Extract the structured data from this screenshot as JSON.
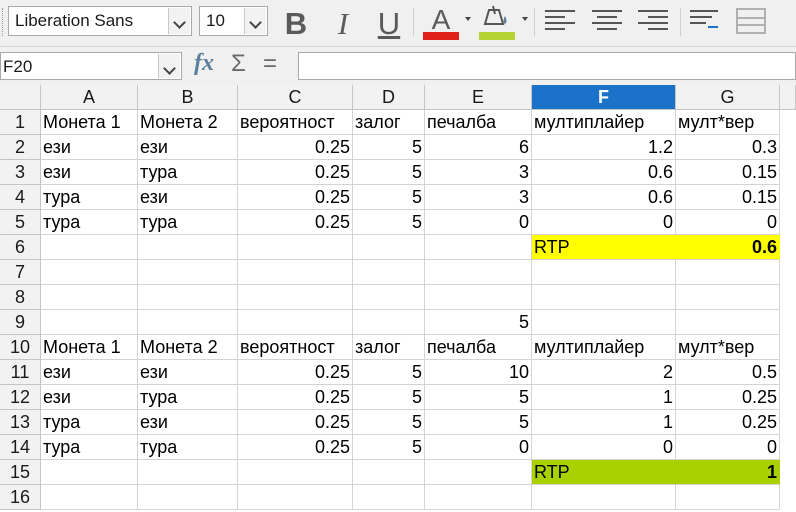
{
  "toolbar": {
    "font_name": "Liberation Sans",
    "font_size": "10",
    "bold_label": "B",
    "italic_label": "I",
    "underline_label": "U",
    "font_color_label": "A",
    "font_color": "#e0201b",
    "highlight_color": "#b5d334"
  },
  "formula_bar": {
    "name_box": "F20",
    "fx_label": "fx",
    "sum_label": "Σ",
    "equals_label": "=",
    "content": ""
  },
  "columns": [
    "A",
    "B",
    "C",
    "D",
    "E",
    "F",
    "G"
  ],
  "selected_column": "F",
  "row_numbers": [
    "1",
    "2",
    "3",
    "4",
    "5",
    "6",
    "7",
    "8",
    "9",
    "10",
    "11",
    "12",
    "13",
    "14",
    "15",
    "16"
  ],
  "cells": [
    {
      "ref": "A1",
      "v": "Монета 1"
    },
    {
      "ref": "B1",
      "v": "Монета 2"
    },
    {
      "ref": "C1",
      "v": "вероятност"
    },
    {
      "ref": "D1",
      "v": "залог"
    },
    {
      "ref": "E1",
      "v": "печалба"
    },
    {
      "ref": "F1",
      "v": "мултиплайер"
    },
    {
      "ref": "G1",
      "v": "мулт*вер"
    },
    {
      "ref": "A2",
      "v": "ези"
    },
    {
      "ref": "B2",
      "v": "ези"
    },
    {
      "ref": "C2",
      "v": "0.25",
      "num": true
    },
    {
      "ref": "D2",
      "v": "5",
      "num": true
    },
    {
      "ref": "E2",
      "v": "6",
      "num": true
    },
    {
      "ref": "F2",
      "v": "1.2",
      "num": true
    },
    {
      "ref": "G2",
      "v": "0.3",
      "num": true
    },
    {
      "ref": "A3",
      "v": "ези"
    },
    {
      "ref": "B3",
      "v": "тура"
    },
    {
      "ref": "C3",
      "v": "0.25",
      "num": true
    },
    {
      "ref": "D3",
      "v": "5",
      "num": true
    },
    {
      "ref": "E3",
      "v": "3",
      "num": true
    },
    {
      "ref": "F3",
      "v": "0.6",
      "num": true
    },
    {
      "ref": "G3",
      "v": "0.15",
      "num": true
    },
    {
      "ref": "A4",
      "v": "тура"
    },
    {
      "ref": "B4",
      "v": "ези"
    },
    {
      "ref": "C4",
      "v": "0.25",
      "num": true
    },
    {
      "ref": "D4",
      "v": "5",
      "num": true
    },
    {
      "ref": "E4",
      "v": "3",
      "num": true
    },
    {
      "ref": "F4",
      "v": "0.6",
      "num": true
    },
    {
      "ref": "G4",
      "v": "0.15",
      "num": true
    },
    {
      "ref": "A5",
      "v": "тура"
    },
    {
      "ref": "B5",
      "v": "тура"
    },
    {
      "ref": "C5",
      "v": "0.25",
      "num": true
    },
    {
      "ref": "D5",
      "v": "5",
      "num": true
    },
    {
      "ref": "E5",
      "v": "0",
      "num": true
    },
    {
      "ref": "F5",
      "v": "0",
      "num": true
    },
    {
      "ref": "G5",
      "v": "0",
      "num": true
    },
    {
      "ref": "F6",
      "v": "RTP",
      "bg": "#ffff00"
    },
    {
      "ref": "G6",
      "v": "0.6",
      "num": true,
      "bold": true,
      "bg": "#ffff00"
    },
    {
      "ref": "E9",
      "v": "5",
      "num": true
    },
    {
      "ref": "A10",
      "v": "Монета 1"
    },
    {
      "ref": "B10",
      "v": "Монета 2"
    },
    {
      "ref": "C10",
      "v": "вероятност"
    },
    {
      "ref": "D10",
      "v": "залог"
    },
    {
      "ref": "E10",
      "v": "печалба"
    },
    {
      "ref": "F10",
      "v": "мултиплайер"
    },
    {
      "ref": "G10",
      "v": "мулт*вер"
    },
    {
      "ref": "A11",
      "v": "ези"
    },
    {
      "ref": "B11",
      "v": "ези"
    },
    {
      "ref": "C11",
      "v": "0.25",
      "num": true
    },
    {
      "ref": "D11",
      "v": "5",
      "num": true
    },
    {
      "ref": "E11",
      "v": "10",
      "num": true
    },
    {
      "ref": "F11",
      "v": "2",
      "num": true
    },
    {
      "ref": "G11",
      "v": "0.5",
      "num": true
    },
    {
      "ref": "A12",
      "v": "ези"
    },
    {
      "ref": "B12",
      "v": "тура"
    },
    {
      "ref": "C12",
      "v": "0.25",
      "num": true
    },
    {
      "ref": "D12",
      "v": "5",
      "num": true
    },
    {
      "ref": "E12",
      "v": "5",
      "num": true
    },
    {
      "ref": "F12",
      "v": "1",
      "num": true
    },
    {
      "ref": "G12",
      "v": "0.25",
      "num": true
    },
    {
      "ref": "A13",
      "v": "тура"
    },
    {
      "ref": "B13",
      "v": "ези"
    },
    {
      "ref": "C13",
      "v": "0.25",
      "num": true
    },
    {
      "ref": "D13",
      "v": "5",
      "num": true
    },
    {
      "ref": "E13",
      "v": "5",
      "num": true
    },
    {
      "ref": "F13",
      "v": "1",
      "num": true
    },
    {
      "ref": "G13",
      "v": "0.25",
      "num": true
    },
    {
      "ref": "A14",
      "v": "тура"
    },
    {
      "ref": "B14",
      "v": "тура"
    },
    {
      "ref": "C14",
      "v": "0.25",
      "num": true
    },
    {
      "ref": "D14",
      "v": "5",
      "num": true
    },
    {
      "ref": "E14",
      "v": "0",
      "num": true
    },
    {
      "ref": "F14",
      "v": "0",
      "num": true
    },
    {
      "ref": "G14",
      "v": "0",
      "num": true
    },
    {
      "ref": "F15",
      "v": "RTP",
      "bg": "#a9d100"
    },
    {
      "ref": "G15",
      "v": "1",
      "num": true,
      "bold": true,
      "bg": "#a9d100"
    }
  ]
}
